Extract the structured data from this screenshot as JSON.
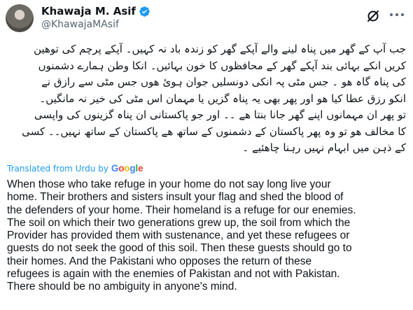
{
  "tweet": {
    "author_name": "Khawaja M. Asif",
    "handle": "@KhawajaMAsif",
    "urdu_lines": [
      "جب آپ کے گھر میں پناہ لینے والے آپکے گھر کو زندہ باد نہ کہیں۔ آپکے پرچم کی توھین",
      "کریں انکے بہائی بند آپکے گھر کے محافظوں کا خون بہائیں۔ انکا وطن ہمارے دشمنوں",
      "کی پناہ گاہ ھو ۔ جس مٹی پہ انکی دونسلیں جوان ہوئ ھوں جس مٹی سے رازق نے",
      "انکو رزق عطا کیا ھو اور پھر بھی یہ پناہ گزیں یا مہمان اس مٹی کی خیر نہ مانگیں۔",
      "تو پھر ان مہمانوں اپنے گھر جانا بنتا ھے ۔۔ اور جو پاکستانی ان پناہ گزینوں کی واپسی",
      "کا مخالف ھو تو وہ پھر پاکستان کے دشمنوں کے ساتھ ھے پاکستان کے ساتھ نہیں۔۔ کسی",
      "کے ذہن میں ابہام نہیں رہنا چاھئیے ۔"
    ],
    "translated_label": "Translated from Urdu by",
    "translated_brand": "Google",
    "english_lines": [
      "When those who take refuge in your home do not say long live your",
      "home. Their brothers and sisters insult your flag and shed the blood of",
      "the defenders of your home. Their homeland is a refuge for our enemies.",
      "The soil on which their two generations grew up, the soil from which the",
      "Provider has provided them with sustenance, and yet these refugees or",
      "guests do not seek the good of this soil. Then these guests should go to",
      "their homes. And the Pakistani who opposes the return of these",
      "refugees is again with the enemies of Pakistan and not with Pakistan.",
      "There should be no ambiguity in anyone's mind."
    ]
  },
  "icons": {
    "verified": "verified-badge-icon",
    "grok": "grok-icon",
    "more": "more-options-icon"
  },
  "colors": {
    "verified_blue": "#1d9bf0",
    "link_blue": "#1d9bf0",
    "secondary_text": "#536471",
    "google_blue": "#4285F4",
    "google_red": "#EA4335",
    "google_yellow": "#FBBC05",
    "google_green": "#34A853"
  }
}
